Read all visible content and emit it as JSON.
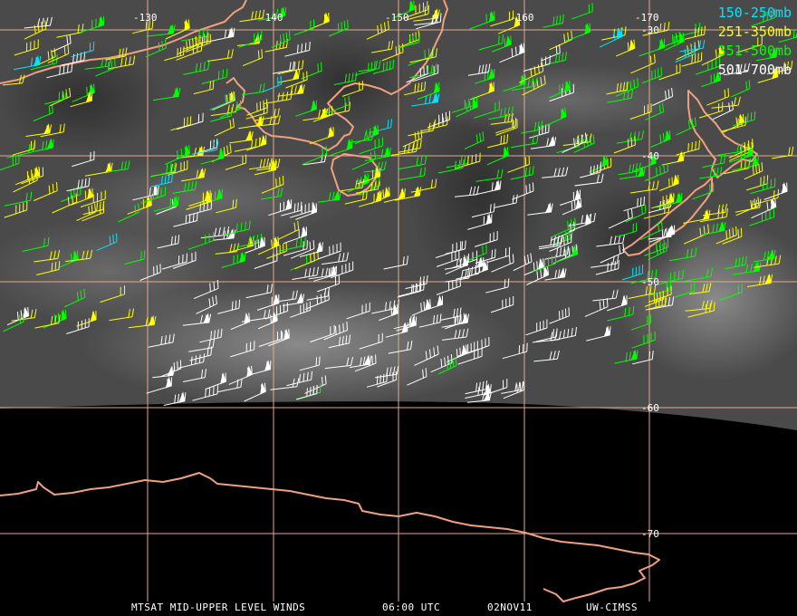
{
  "legend": [
    {
      "label": "150-250mb",
      "color": "#00e5ff"
    },
    {
      "label": "251-350mb",
      "color": "#ffff00"
    },
    {
      "label": "351-500mb",
      "color": "#00ff00"
    },
    {
      "label": "501-700mb",
      "color": "#ffffff"
    }
  ],
  "longitude_labels": [
    "-130",
    "-140",
    "-150",
    "-160",
    "-170"
  ],
  "latitude_labels": [
    "-30",
    "-40",
    "-50",
    "-60",
    "-70"
  ],
  "footer": {
    "product": "MTSAT MID-UPPER LEVEL WINDS",
    "time": "06:00 UTC",
    "date": "02NOV11",
    "source": "UW-CIMSS"
  },
  "colors": {
    "grid": "#e6a98a",
    "coastline": "#f0a07e",
    "satellite_background": "#4a4a4a",
    "no_data": "#000000"
  }
}
